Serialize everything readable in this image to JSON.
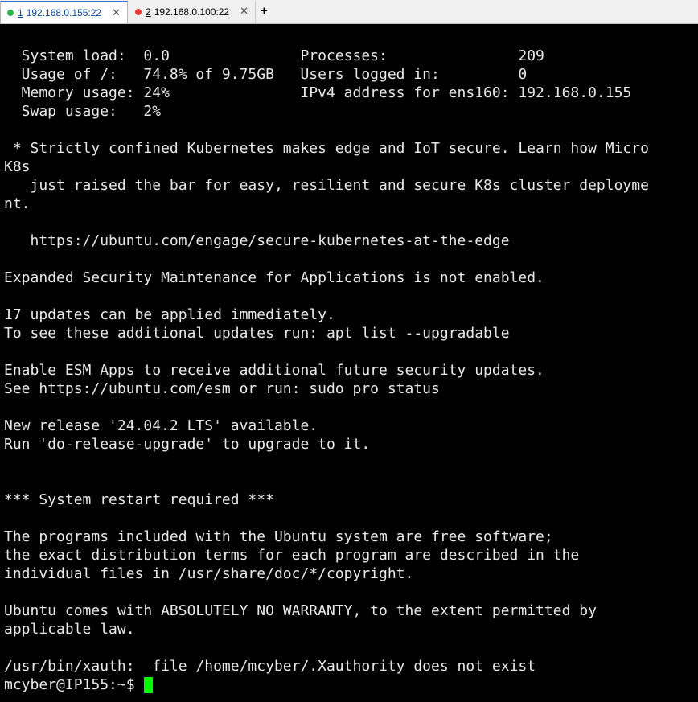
{
  "tabs": [
    {
      "number": "1",
      "title": "192.168.0.155:22",
      "status_color": "#2db84d",
      "active": true
    },
    {
      "number": "2",
      "title": "192.168.0.100:22",
      "status_color": "#e53935",
      "active": false
    }
  ],
  "new_tab_label": "+",
  "close_glyph": "✕",
  "terminal": {
    "lines": [
      "  System load:  0.0               Processes:               209",
      "  Usage of /:   74.8% of 9.75GB   Users logged in:         0",
      "  Memory usage: 24%               IPv4 address for ens160: 192.168.0.155",
      "  Swap usage:   2%",
      "",
      " * Strictly confined Kubernetes makes edge and IoT secure. Learn how Micro",
      "K8s",
      "   just raised the bar for easy, resilient and secure K8s cluster deployme",
      "nt.",
      "",
      "   https://ubuntu.com/engage/secure-kubernetes-at-the-edge",
      "",
      "Expanded Security Maintenance for Applications is not enabled.",
      "",
      "17 updates can be applied immediately.",
      "To see these additional updates run: apt list --upgradable",
      "",
      "Enable ESM Apps to receive additional future security updates.",
      "See https://ubuntu.com/esm or run: sudo pro status",
      "",
      "New release '24.04.2 LTS' available.",
      "Run 'do-release-upgrade' to upgrade to it.",
      "",
      "",
      "*** System restart required ***",
      "",
      "The programs included with the Ubuntu system are free software;",
      "the exact distribution terms for each program are described in the",
      "individual files in /usr/share/doc/*/copyright.",
      "",
      "Ubuntu comes with ABSOLUTELY NO WARRANTY, to the extent permitted by",
      "applicable law.",
      "",
      "/usr/bin/xauth:  file /home/mcyber/.Xauthority does not exist"
    ],
    "prompt": "mcyber@IP155:~$ ",
    "cursor_color": "#00ff00"
  }
}
